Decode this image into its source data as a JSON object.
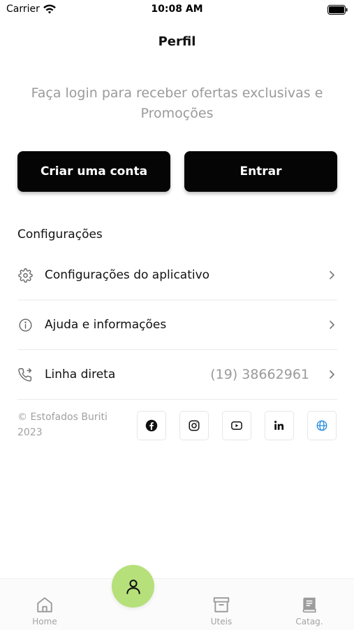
{
  "status_bar": {
    "carrier": "Carrier",
    "time": "10:08 AM"
  },
  "header": {
    "title": "Perfil"
  },
  "login_prompt": "Faça login para receber ofertas exclusivas e Promoções",
  "buttons": {
    "create_account": "Criar uma conta",
    "login": "Entrar"
  },
  "settings": {
    "section_title": "Configurações",
    "items": [
      {
        "label": "Configurações do aplicativo",
        "icon": "gear-icon"
      },
      {
        "label": "Ajuda e informações",
        "icon": "info-icon"
      },
      {
        "label": "Linha direta",
        "value": "(19) 38662961",
        "icon": "phone-icon"
      }
    ]
  },
  "footer": {
    "copyright_line1": "© Estofados Buriti",
    "copyright_line2": "2023",
    "social": [
      "facebook-icon",
      "instagram-icon",
      "youtube-icon",
      "linkedin-icon",
      "globe-icon"
    ]
  },
  "tab_bar": {
    "items": [
      {
        "label": "Home",
        "icon": "home-icon"
      },
      {
        "label": "Uteis",
        "icon": "archive-icon"
      },
      {
        "label": "Catag.",
        "icon": "book-icon"
      }
    ],
    "active": "profile",
    "accent": "#b6e07a"
  },
  "colors": {
    "button_bg": "#050505",
    "muted_text": "#9a9a9a",
    "globe_blue": "#2d8fe0"
  }
}
